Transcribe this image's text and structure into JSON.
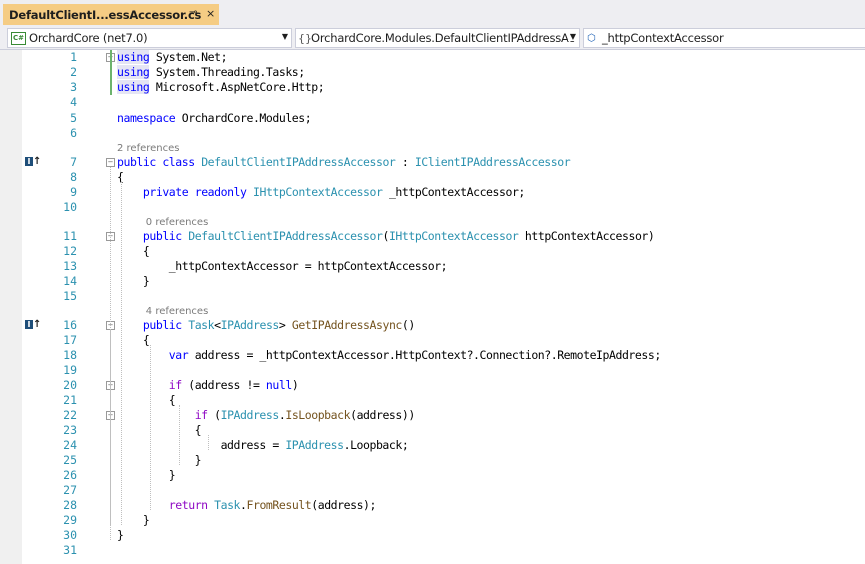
{
  "tab": {
    "title": "DefaultClientI...essAccessor.cs",
    "pin_glyph": "⊸",
    "close_glyph": "×"
  },
  "navbar": {
    "project": "OrchardCore (net7.0)",
    "type": "OrchardCore.Modules.DefaultClientIPAddressAc",
    "member": "_httpContextAccessor",
    "dropdown_glyph": "▼"
  },
  "colors": {
    "keyword": "#0000ff",
    "type": "#2b91af",
    "method": "#74531f",
    "control": "#8f08c4",
    "line_number": "#2b91af",
    "codelens": "#7a7a7a",
    "tab_active": "#f5cc84"
  },
  "icons": {
    "cs_project": "cs-project-icon",
    "namespace": "namespace-icon",
    "field": "field-icon",
    "implements": "implements-icon"
  },
  "editor": {
    "lines": [
      {
        "n": "1",
        "segs": [
          {
            "c": "kw usingkw",
            "t": "using"
          },
          {
            "c": "",
            "t": " System.Net;"
          }
        ]
      },
      {
        "n": "2",
        "segs": [
          {
            "c": "kw usingkw",
            "t": "using"
          },
          {
            "c": "",
            "t": " System.Threading.Tasks;"
          }
        ]
      },
      {
        "n": "3",
        "segs": [
          {
            "c": "kw usingkw",
            "t": "using"
          },
          {
            "c": "",
            "t": " Microsoft.AspNetCore.Http;"
          }
        ]
      },
      {
        "n": "4",
        "segs": []
      },
      {
        "n": "5",
        "segs": [
          {
            "c": "kw",
            "t": "namespace"
          },
          {
            "c": "",
            "t": " OrchardCore.Modules;"
          }
        ]
      },
      {
        "n": "6",
        "segs": []
      },
      {
        "n": "7",
        "segs": [
          {
            "c": "kw",
            "t": "public"
          },
          {
            "c": "",
            "t": " "
          },
          {
            "c": "kw",
            "t": "class"
          },
          {
            "c": "",
            "t": " "
          },
          {
            "c": "ty",
            "t": "DefaultClientIPAddressAccessor"
          },
          {
            "c": "",
            "t": " : "
          },
          {
            "c": "ty",
            "t": "IClientIPAddressAccessor"
          }
        ]
      },
      {
        "n": "8",
        "segs": [
          {
            "c": "",
            "t": "{"
          }
        ]
      },
      {
        "n": "9",
        "segs": [
          {
            "c": "",
            "t": "    "
          },
          {
            "c": "kw",
            "t": "private"
          },
          {
            "c": "",
            "t": " "
          },
          {
            "c": "kw",
            "t": "readonly"
          },
          {
            "c": "",
            "t": " "
          },
          {
            "c": "ty",
            "t": "IHttpContextAccessor"
          },
          {
            "c": "",
            "t": " _httpContextAccessor;"
          }
        ]
      },
      {
        "n": "10",
        "segs": []
      },
      {
        "n": "11",
        "segs": [
          {
            "c": "",
            "t": "    "
          },
          {
            "c": "kw",
            "t": "public"
          },
          {
            "c": "",
            "t": " "
          },
          {
            "c": "ty",
            "t": "DefaultClientIPAddressAccessor"
          },
          {
            "c": "",
            "t": "("
          },
          {
            "c": "ty",
            "t": "IHttpContextAccessor"
          },
          {
            "c": "",
            "t": " httpContextAccessor)"
          }
        ]
      },
      {
        "n": "12",
        "segs": [
          {
            "c": "",
            "t": "    {"
          }
        ]
      },
      {
        "n": "13",
        "segs": [
          {
            "c": "",
            "t": "        _httpContextAccessor = httpContextAccessor;"
          }
        ]
      },
      {
        "n": "14",
        "segs": [
          {
            "c": "",
            "t": "    }"
          }
        ]
      },
      {
        "n": "15",
        "segs": []
      },
      {
        "n": "16",
        "segs": [
          {
            "c": "",
            "t": "    "
          },
          {
            "c": "kw",
            "t": "public"
          },
          {
            "c": "",
            "t": " "
          },
          {
            "c": "ty",
            "t": "Task"
          },
          {
            "c": "",
            "t": "<"
          },
          {
            "c": "ty",
            "t": "IPAddress"
          },
          {
            "c": "",
            "t": "> "
          },
          {
            "c": "fn",
            "t": "GetIPAddressAsync"
          },
          {
            "c": "",
            "t": "()"
          }
        ]
      },
      {
        "n": "17",
        "segs": [
          {
            "c": "",
            "t": "    {"
          }
        ]
      },
      {
        "n": "18",
        "segs": [
          {
            "c": "",
            "t": "        "
          },
          {
            "c": "kw",
            "t": "var"
          },
          {
            "c": "",
            "t": " address = _httpContextAccessor.HttpContext?.Connection?.RemoteIpAddress;"
          }
        ]
      },
      {
        "n": "19",
        "segs": []
      },
      {
        "n": "20",
        "segs": [
          {
            "c": "",
            "t": "        "
          },
          {
            "c": "ctl",
            "t": "if"
          },
          {
            "c": "",
            "t": " (address != "
          },
          {
            "c": "kw",
            "t": "null"
          },
          {
            "c": "",
            "t": ")"
          }
        ]
      },
      {
        "n": "21",
        "segs": [
          {
            "c": "",
            "t": "        {"
          }
        ]
      },
      {
        "n": "22",
        "segs": [
          {
            "c": "",
            "t": "            "
          },
          {
            "c": "ctl",
            "t": "if"
          },
          {
            "c": "",
            "t": " ("
          },
          {
            "c": "ty",
            "t": "IPAddress"
          },
          {
            "c": "",
            "t": "."
          },
          {
            "c": "fn",
            "t": "IsLoopback"
          },
          {
            "c": "",
            "t": "(address))"
          }
        ]
      },
      {
        "n": "23",
        "segs": [
          {
            "c": "",
            "t": "            {"
          }
        ]
      },
      {
        "n": "24",
        "segs": [
          {
            "c": "",
            "t": "                address = "
          },
          {
            "c": "ty",
            "t": "IPAddress"
          },
          {
            "c": "",
            "t": ".Loopback;"
          }
        ]
      },
      {
        "n": "25",
        "segs": [
          {
            "c": "",
            "t": "            }"
          }
        ]
      },
      {
        "n": "26",
        "segs": [
          {
            "c": "",
            "t": "        }"
          }
        ]
      },
      {
        "n": "27",
        "segs": []
      },
      {
        "n": "28",
        "segs": [
          {
            "c": "",
            "t": "        "
          },
          {
            "c": "ctl",
            "t": "return"
          },
          {
            "c": "",
            "t": " "
          },
          {
            "c": "ty",
            "t": "Task"
          },
          {
            "c": "",
            "t": "."
          },
          {
            "c": "fn",
            "t": "FromResult"
          },
          {
            "c": "",
            "t": "(address);"
          }
        ]
      },
      {
        "n": "29",
        "segs": [
          {
            "c": "",
            "t": "    }"
          }
        ]
      },
      {
        "n": "30",
        "segs": [
          {
            "c": "",
            "t": "}"
          }
        ]
      },
      {
        "n": "31",
        "segs": []
      }
    ],
    "codelens": [
      {
        "before_line": "7",
        "text": "2 references"
      },
      {
        "before_line": "11",
        "text": "0 references"
      },
      {
        "before_line": "16",
        "text": "4 references"
      }
    ],
    "implements_lines": [
      "7",
      "16"
    ],
    "fold_lines": [
      "1",
      "7",
      "11",
      "16",
      "20",
      "22"
    ],
    "fold_glyph": "−",
    "implements_glyph_i": "I",
    "implements_glyph_arrow": "↑"
  }
}
